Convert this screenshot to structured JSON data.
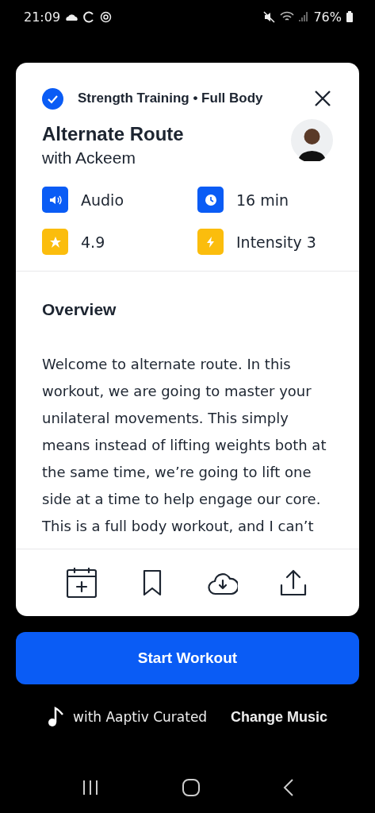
{
  "status_bar": {
    "time": "21:09",
    "battery": "76%"
  },
  "sheet": {
    "category": "Strength Training • Full Body",
    "completed": true,
    "title": "Alternate Route",
    "subtitle": "with Ackeem",
    "stats": [
      {
        "kind": "audio",
        "label": "Audio",
        "color": "#0a5cf5"
      },
      {
        "kind": "time",
        "label": "16 min",
        "color": "#0a5cf5"
      },
      {
        "kind": "rating",
        "label": "4.9",
        "color": "#fbbd0d"
      },
      {
        "kind": "intensity",
        "label": "Intensity 3",
        "color": "#fbbd0d"
      }
    ],
    "overview_heading": "Overview",
    "overview_text": "Welcome to alternate route. In this workout, we are going to master your unilateral movements. This simply means instead of lifting weights both at the same time, we’re going to lift one side at a time to help engage our core. This is a full body workout, and I can’t",
    "actions": [
      {
        "kind": "schedule"
      },
      {
        "kind": "bookmark"
      },
      {
        "kind": "download"
      },
      {
        "kind": "share"
      }
    ]
  },
  "start_button": "Start Workout",
  "music": {
    "label": "with Aaptiv Curated",
    "action": "Change Music"
  }
}
